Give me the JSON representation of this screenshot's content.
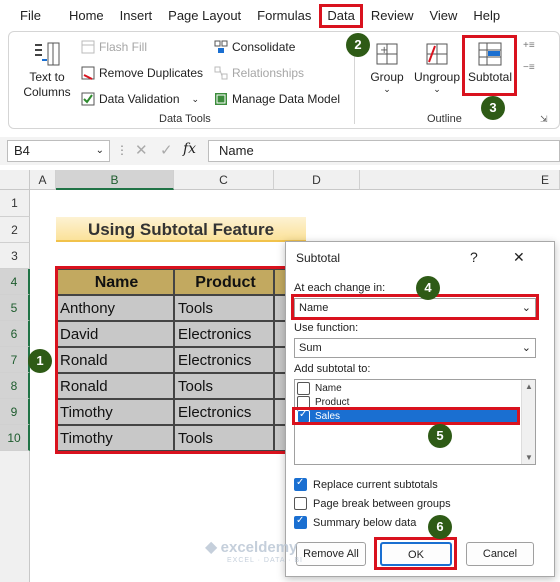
{
  "menu": {
    "tabs": [
      "File",
      "Home",
      "Insert",
      "Page Layout",
      "Formulas",
      "Data",
      "Review",
      "View",
      "Help"
    ],
    "active_index": 5
  },
  "ribbon": {
    "text_to_columns": "Text to\nColumns",
    "flash_fill": "Flash Fill",
    "remove_duplicates": "Remove Duplicates",
    "data_validation": "Data Validation",
    "consolidate": "Consolidate",
    "relationships": "Relationships",
    "manage_data_model": "Manage Data Model",
    "data_tools_label": "Data Tools",
    "group": "Group",
    "ungroup": "Ungroup",
    "subtotal": "Subtotal",
    "outline_label": "Outline"
  },
  "formula_bar": {
    "name_box": "B4",
    "fx": "fx",
    "content": "Name"
  },
  "columns": [
    "A",
    "B",
    "C",
    "D",
    "E"
  ],
  "rows": [
    "1",
    "2",
    "3",
    "4",
    "5",
    "6",
    "7",
    "8",
    "9",
    "10"
  ],
  "sheet": {
    "title": "Using Subtotal Feature",
    "headers": [
      "Name",
      "Product"
    ],
    "data": [
      [
        "Anthony",
        "Tools"
      ],
      [
        "David",
        "Electronics"
      ],
      [
        "Ronald",
        "Electronics"
      ],
      [
        "Ronald",
        "Tools"
      ],
      [
        "Timothy",
        "Electronics"
      ],
      [
        "Timothy",
        "Tools"
      ]
    ]
  },
  "dialog": {
    "title": "Subtotal",
    "help": "?",
    "close": "✕",
    "at_each_change_label": "At each change in:",
    "at_each_change_value": "Name",
    "use_function_label": "Use function:",
    "use_function_value": "Sum",
    "add_subtotal_label": "Add subtotal to:",
    "fields": [
      {
        "name": "Name",
        "checked": false
      },
      {
        "name": "Product",
        "checked": false
      },
      {
        "name": "Sales",
        "checked": true
      }
    ],
    "replace_current": "Replace current subtotals",
    "page_break": "Page break between groups",
    "summary_below": "Summary below data",
    "remove_all": "Remove All",
    "ok": "OK",
    "cancel": "Cancel"
  },
  "watermark": {
    "brand": "exceldemy",
    "tagline": "EXCEL · DATA · BI"
  },
  "badges": [
    "1",
    "2",
    "3",
    "4",
    "5",
    "6"
  ],
  "colors": {
    "accent_red": "#d9121e",
    "badge_green": "#2e5b16",
    "header_fill": "#c2a960",
    "data_fill": "#c8c8c8",
    "title_fill": "#fdefc8",
    "select_blue": "#1a6fd1"
  }
}
